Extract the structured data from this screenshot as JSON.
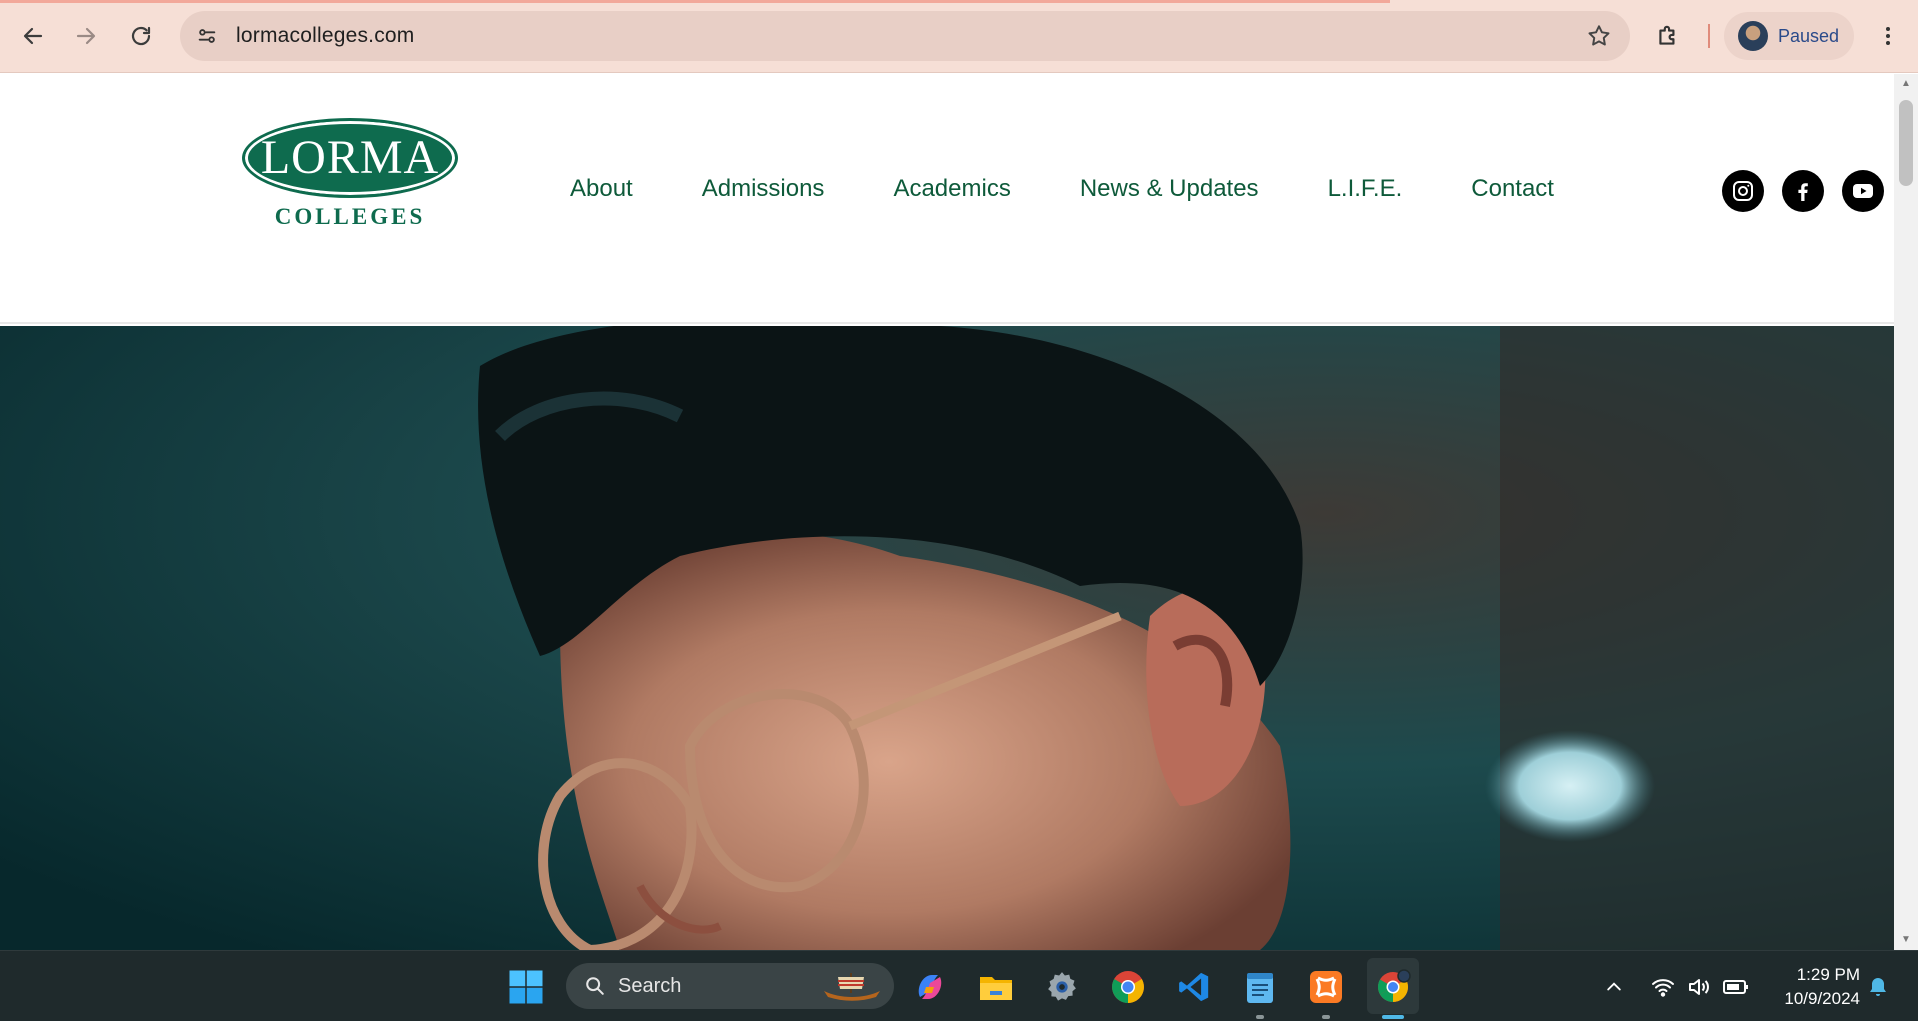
{
  "browser": {
    "url": "lormacolleges.com",
    "profile_status": "Paused",
    "colors": {
      "chrome_bg": "#f6dfd6",
      "omnibox_bg": "#e8cfc6",
      "profile_text": "#2a4a8a"
    }
  },
  "site": {
    "logo": {
      "word": "LORMA",
      "sub": "COLLEGES"
    },
    "nav": [
      {
        "label": "About"
      },
      {
        "label": "Admissions"
      },
      {
        "label": "Academics"
      },
      {
        "label": "News & Updates"
      },
      {
        "label": "L.I.F.E."
      },
      {
        "label": "Contact"
      }
    ],
    "social": [
      {
        "icon": "instagram-icon"
      },
      {
        "icon": "facebook-icon"
      },
      {
        "icon": "youtube-icon"
      }
    ],
    "colors": {
      "brand_green": "#0e6b4e",
      "nav_text": "#0e5a3a"
    }
  },
  "taskbar": {
    "search_placeholder": "Search",
    "apps": [
      "copilot-icon",
      "file-explorer-icon",
      "settings-icon",
      "chrome-icon",
      "vscode-icon",
      "notepad-icon",
      "xampp-icon",
      "chrome-profile-icon"
    ],
    "clock": {
      "time": "1:29 PM",
      "date": "10/9/2024"
    }
  }
}
